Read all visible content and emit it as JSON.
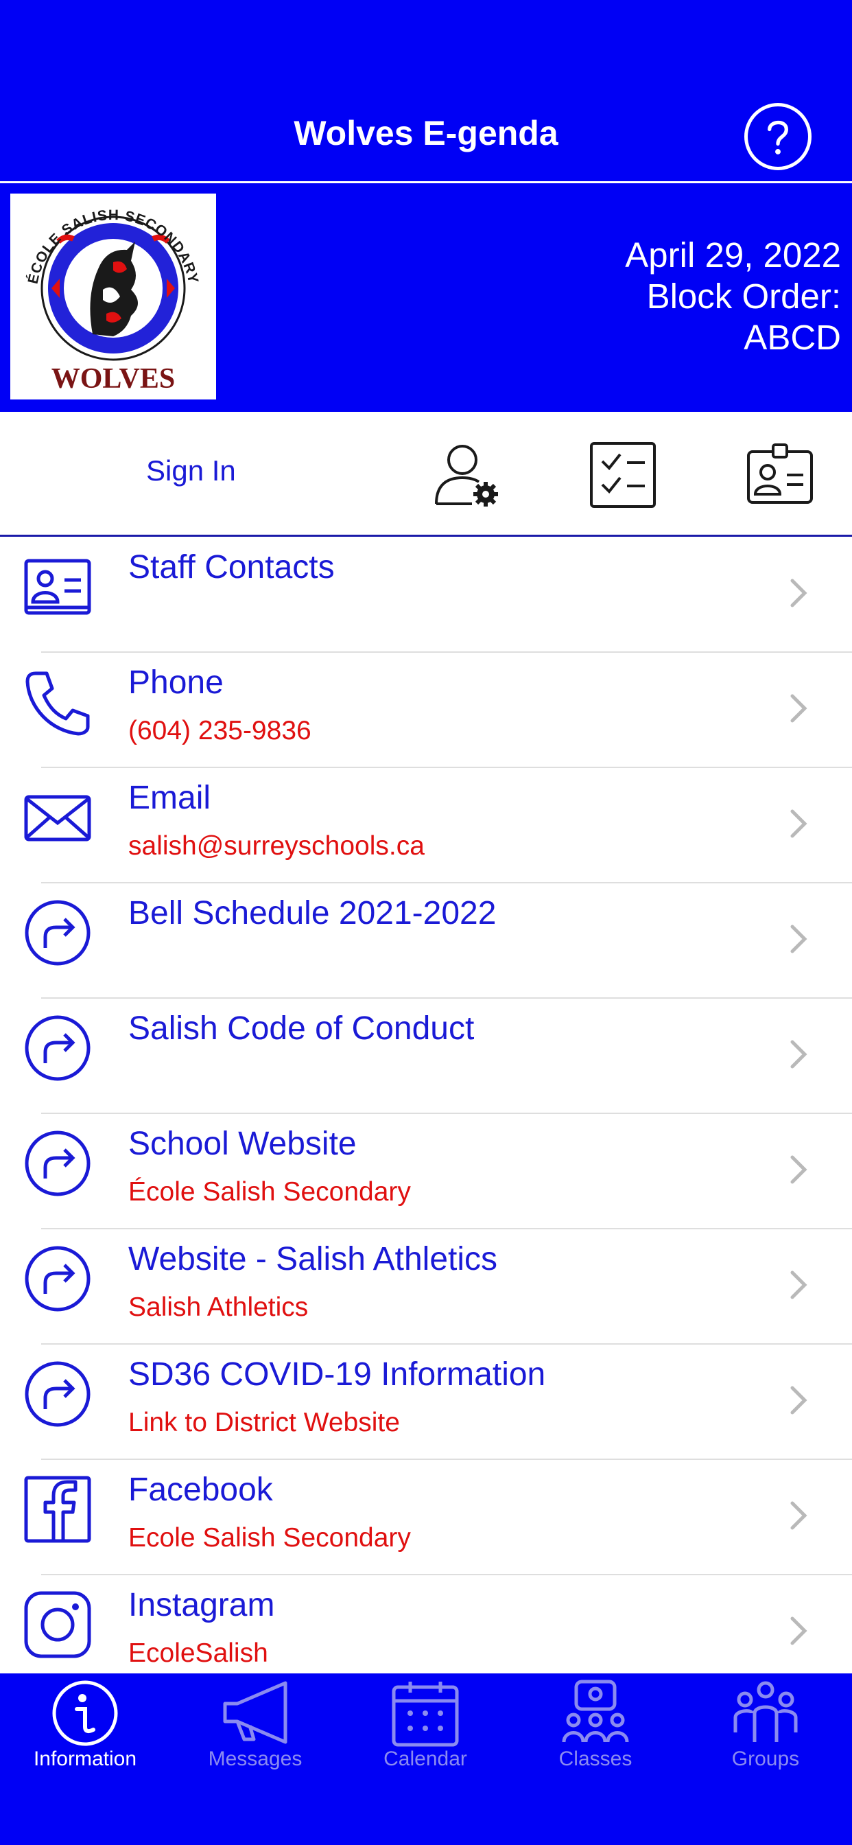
{
  "header": {
    "title": "Wolves E-genda",
    "help_icon": "question-circle-icon"
  },
  "banner": {
    "logo_top_text": "ÉCOLE SALISH SECONDARY",
    "logo_bottom_text": "WOLVES",
    "date": "April 29, 2022",
    "block_order_label": "Block Order:",
    "block_order_value": "ABCD"
  },
  "actions": {
    "sign_in": "Sign In",
    "icons": [
      "user-settings-icon",
      "checklist-icon",
      "id-badge-icon"
    ]
  },
  "menu": [
    {
      "title": "Staff Contacts",
      "subtitle": "",
      "icon": "contact-card-icon"
    },
    {
      "title": "Phone",
      "subtitle": "(604) 235-9836",
      "icon": "phone-icon"
    },
    {
      "title": "Email",
      "subtitle": "salish@surreyschools.ca",
      "icon": "envelope-icon"
    },
    {
      "title": "Bell Schedule 2021-2022",
      "subtitle": "",
      "icon": "redirect-arrow-icon"
    },
    {
      "title": "Salish Code of Conduct",
      "subtitle": "",
      "icon": "redirect-arrow-icon"
    },
    {
      "title": "School Website",
      "subtitle": "École Salish Secondary",
      "icon": "redirect-arrow-icon"
    },
    {
      "title": "Website - Salish Athletics",
      "subtitle": "Salish Athletics",
      "icon": "redirect-arrow-icon"
    },
    {
      "title": "SD36 COVID-19 Information",
      "subtitle": "Link to District Website",
      "icon": "redirect-arrow-icon"
    },
    {
      "title": "Facebook",
      "subtitle": "Ecole Salish Secondary",
      "icon": "facebook-icon"
    },
    {
      "title": "Instagram",
      "subtitle": "EcoleSalish",
      "icon": "instagram-icon"
    }
  ],
  "tabs": [
    {
      "label": "Information",
      "icon": "info-icon",
      "active": true
    },
    {
      "label": "Messages",
      "icon": "megaphone-icon",
      "active": false
    },
    {
      "label": "Calendar",
      "icon": "calendar-icon",
      "active": false
    },
    {
      "label": "Classes",
      "icon": "classes-icon",
      "active": false
    },
    {
      "label": "Groups",
      "icon": "groups-icon",
      "active": false
    }
  ],
  "colors": {
    "brand_blue": "#0000f5",
    "link_blue": "#1a1ad6",
    "subtitle_red": "#e01010",
    "inactive_tab": "#8b8bf0"
  }
}
